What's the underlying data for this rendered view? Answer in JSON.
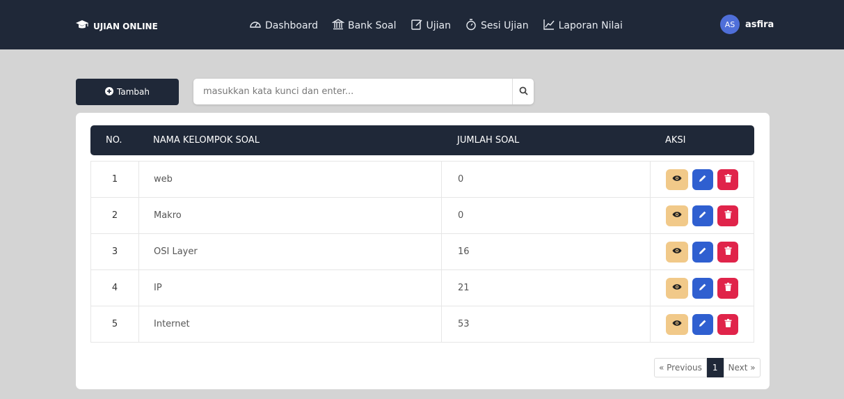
{
  "header": {
    "brand": "UJIAN ONLINE",
    "nav": [
      {
        "label": "Dashboard",
        "icon": "speedometer-icon"
      },
      {
        "label": "Bank Soal",
        "icon": "bank-icon"
      },
      {
        "label": "Ujian",
        "icon": "edit-icon"
      },
      {
        "label": "Sesi Ujian",
        "icon": "stopwatch-icon"
      },
      {
        "label": "Laporan Nilai",
        "icon": "chart-line-icon"
      }
    ],
    "user": {
      "initials": "AS",
      "name": "asfira"
    }
  },
  "toolbar": {
    "add_label": "Tambah",
    "search_placeholder": "masukkan kata kunci dan enter..."
  },
  "table": {
    "columns": [
      "NO.",
      "NAMA KELOMPOK SOAL",
      "JUMLAH SOAL",
      "AKSI"
    ],
    "rows": [
      {
        "no": "1",
        "name": "web",
        "count": "0"
      },
      {
        "no": "2",
        "name": "Makro",
        "count": "0"
      },
      {
        "no": "3",
        "name": "OSI Layer",
        "count": "16"
      },
      {
        "no": "4",
        "name": "IP",
        "count": "21"
      },
      {
        "no": "5",
        "name": "Internet",
        "count": "53"
      }
    ]
  },
  "pagination": {
    "prev": "« Previous",
    "current": "1",
    "next": "Next »"
  },
  "colors": {
    "navy": "#1f2838",
    "view": "#f1c989",
    "edit": "#2f5fd0",
    "delete": "#e0244a",
    "avatar": "#4f6fd9"
  }
}
